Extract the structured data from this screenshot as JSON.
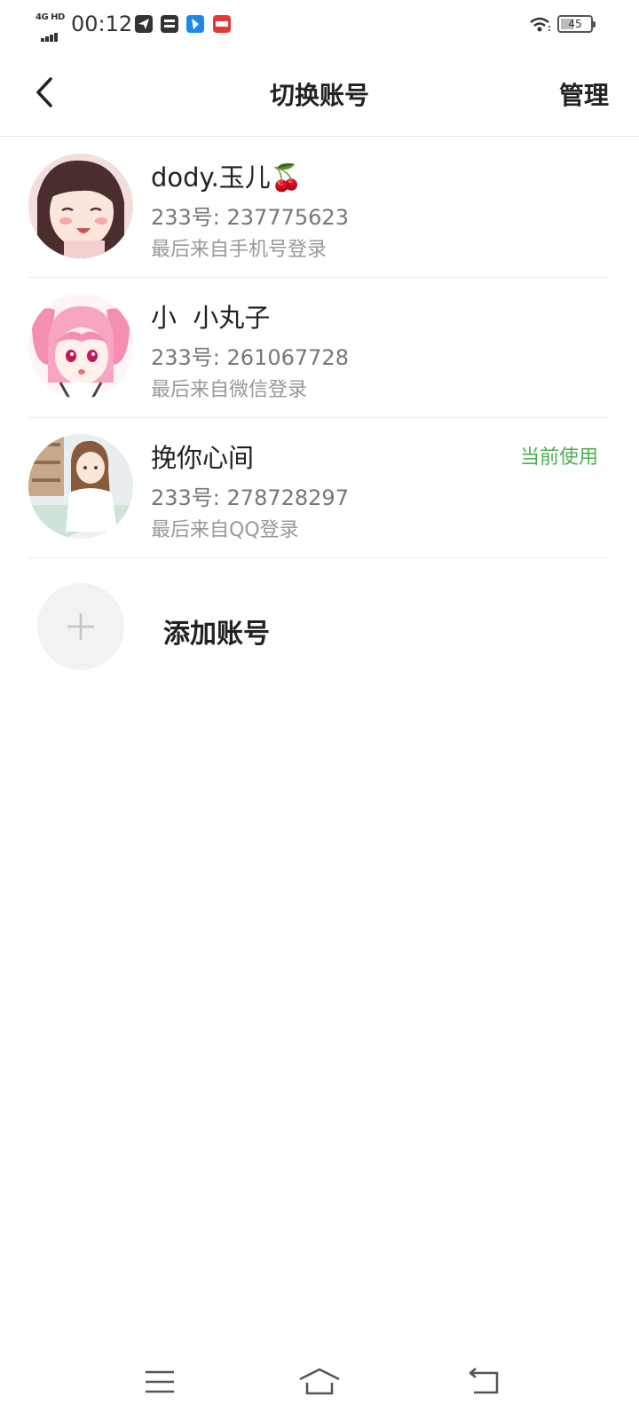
{
  "status_bar": {
    "network": "4G HD",
    "time": "00:12",
    "battery": "45",
    "battery_level": 0.45
  },
  "header": {
    "title": "切换账号",
    "manage_label": "管理"
  },
  "accounts": [
    {
      "name": "dody.玉儿🍒",
      "id_label": "233号: ",
      "id_value": "237775623",
      "source": "最后来自手机号登录",
      "badge": ""
    },
    {
      "name": "小  小丸子",
      "id_label": "233号: ",
      "id_value": "261067728",
      "source": "最后来自微信登录",
      "badge": ""
    },
    {
      "name": "挽你心间",
      "id_label": "233号: ",
      "id_value": "278728297",
      "source": "最后来自QQ登录",
      "badge": "当前使用"
    }
  ],
  "add_account": {
    "label": "添加账号"
  },
  "colors": {
    "accent_green": "#4caf50",
    "divider": "#ececec",
    "text_primary": "#222222",
    "text_secondary": "#777777"
  },
  "icons": {
    "back": "chevron-left-icon",
    "add": "plus-icon",
    "nav_menu": "menu-icon",
    "nav_home": "home-icon",
    "nav_back": "return-icon"
  }
}
